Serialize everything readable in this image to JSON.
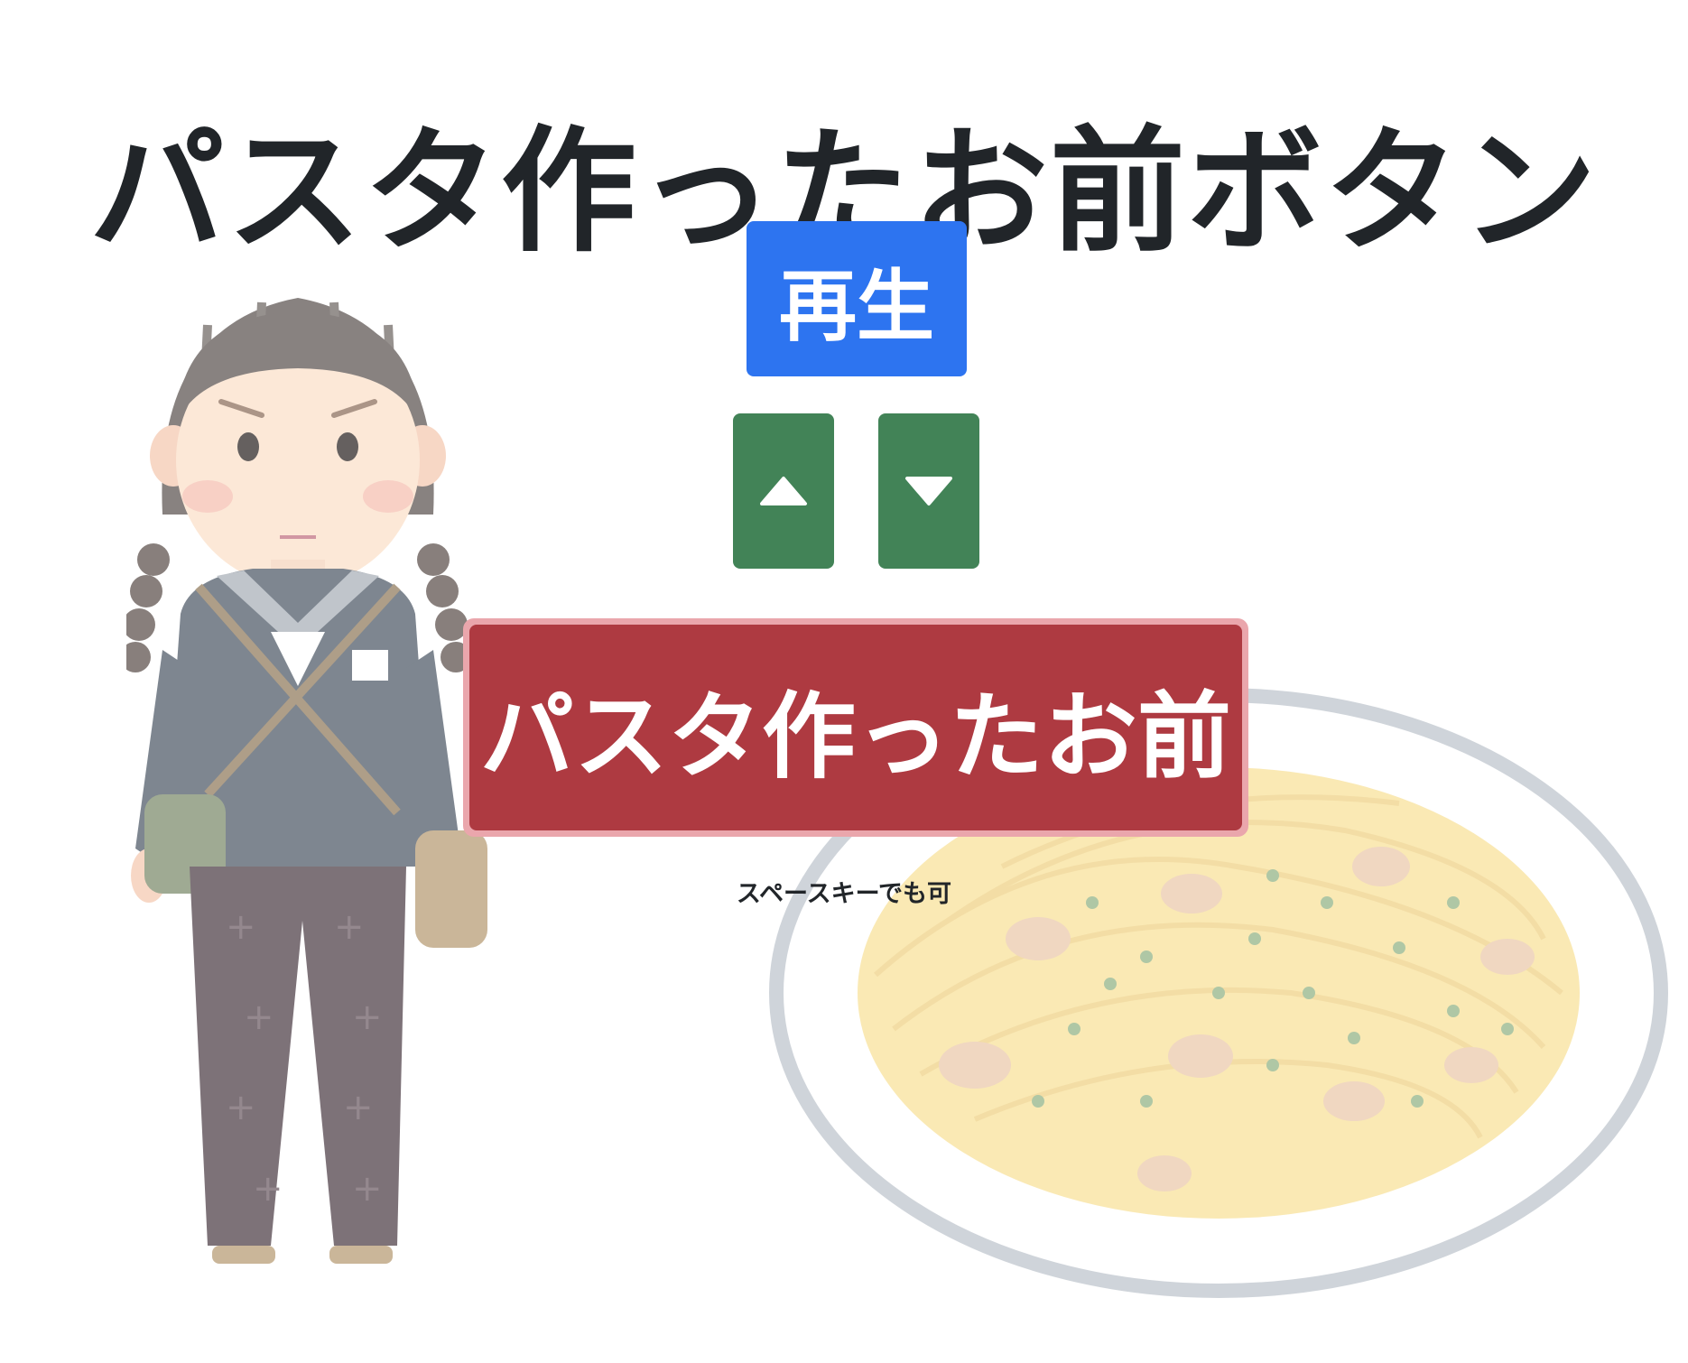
{
  "page": {
    "title": "パスタ作ったお前ボタン"
  },
  "controls": {
    "play_label": "再生",
    "volume_up_icon": "triangle-up-icon",
    "volume_down_icon": "triangle-down-icon",
    "main_button_label": "パスタ作ったお前",
    "hint": "スペースキーでも可"
  },
  "colors": {
    "play_button": "#2d74f0",
    "volume_buttons": "#428357",
    "main_button": "#ae3a41",
    "main_button_ring": "#eaa6ac",
    "text": "#212529"
  },
  "illustrations": {
    "left": "schoolgirl-illustration",
    "right": "pasta-plate-illustration"
  }
}
